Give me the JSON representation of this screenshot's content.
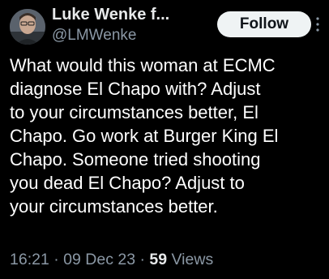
{
  "author": {
    "display_name": "Luke Wenke f...",
    "handle": "@LMWenke"
  },
  "follow_label": "Follow",
  "tweet": {
    "text": "What would this woman at ECMC\ndiagnose El Chapo with?  Adjust\nto your circumstances better, El\nChapo.  Go work at Burger King El\nChapo.  Someone tried shooting\nyou dead El Chapo?  Adjust to\nyour circumstances better."
  },
  "meta": {
    "time": "16:21",
    "sep1": " · ",
    "date": "09 Dec 23",
    "sep2": " · ",
    "views_count": "59",
    "views_label": " Views"
  }
}
